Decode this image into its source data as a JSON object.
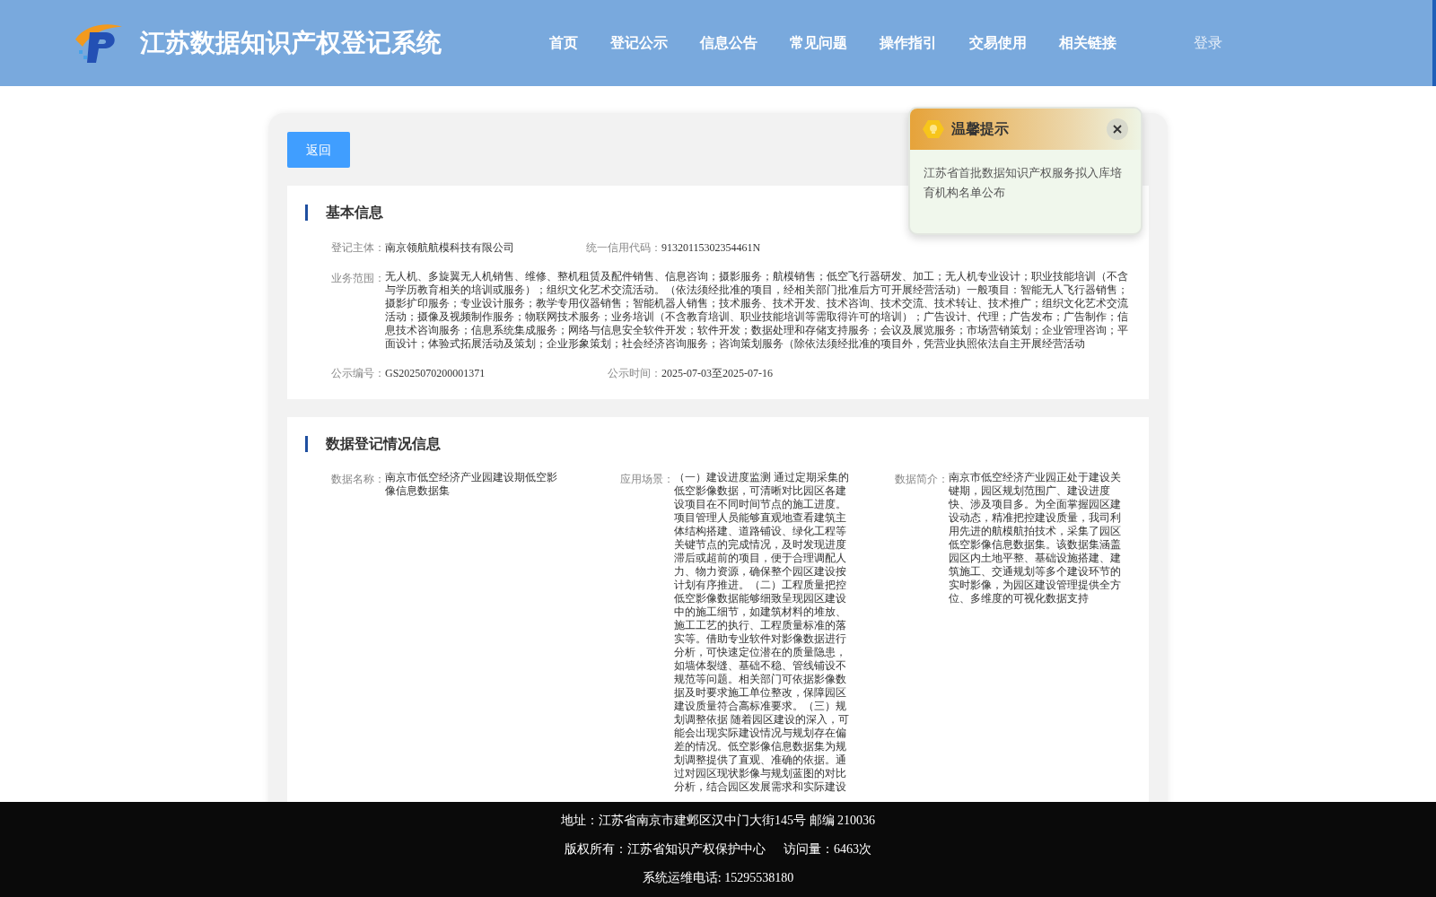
{
  "header": {
    "title": "江苏数据知识产权登记系统",
    "nav": [
      "首页",
      "登记公示",
      "信息公告",
      "常见问题",
      "操作指引",
      "交易使用",
      "相关链接"
    ],
    "login": "登录"
  },
  "back_button": "返回",
  "basic_info": {
    "heading": "基本信息",
    "fields": [
      {
        "label": "登记主体：",
        "value": "南京领航航模科技有限公司"
      },
      {
        "label": "统一信用代码：",
        "value": "91320115302354461N"
      },
      {
        "label": "业务范围：",
        "value": "无人机、多旋翼无人机销售、维修、整机租赁及配件销售、信息咨询；摄影服务；航模销售；低空飞行器研发、加工；无人机专业设计；职业技能培训（不含与学历教育相关的培训或服务）；组织文化艺术交流活动。（依法须经批准的项目，经相关部门批准后方可开展经营活动）一般项目：智能无人飞行器销售；摄影扩印服务；专业设计服务；教学专用仪器销售；智能机器人销售；技术服务、技术开发、技术咨询、技术交流、技术转让、技术推广；组织文化艺术交流活动；摄像及视频制作服务；物联网技术服务；业务培训（不含教育培训、职业技能培训等需取得许可的培训）；广告设计、代理；广告发布；广告制作；信息技术咨询服务；信息系统集成服务；网络与信息安全软件开发；软件开发；数据处理和存储支持服务；会议及展览服务；市场营销策划；企业管理咨询；平面设计；体验式拓展活动及策划；企业形象策划；社会经济咨询服务；咨询策划服务（除依法须经批准的项目外，凭营业执照依法自主开展经营活动"
      },
      {
        "label": "公示编号：",
        "value": "GS2025070200001371"
      },
      {
        "label": "公示时间：",
        "value": "2025-07-03至2025-07-16"
      }
    ]
  },
  "data_info": {
    "heading": "数据登记情况信息",
    "fields": [
      {
        "label": "数据名称：",
        "value": "南京市低空经济产业园建设期低空影像信息数据集"
      },
      {
        "label": "应用场景：",
        "value": "（一）建设进度监测 通过定期采集的低空影像数据，可清晰对比园区各建设项目在不同时间节点的施工进度。项目管理人员能够直观地查看建筑主体结构搭建、道路铺设、绿化工程等关键节点的完成情况，及时发现进度滞后或超前的项目，便于合理调配人力、物力资源，确保整个园区建设按计划有序推进。（二）工程质量把控低空影像数据能够细致呈现园区建设中的施工细节，如建筑材料的堆放、施工工艺的执行、工程质量标准的落实等。借助专业软件对影像数据进行分析，可快速定位潜在的质量隐患，如墙体裂缝、基础不稳、管线铺设不规范等问题。相关部门可依据影像数据及时要求施工单位整改，保障园区建设质量符合高标准要求。（三）规划调整依据 随着园区建设的深入，可能会出现实际建设情况与规划存在偏差的情况。低空影像信息数据集为规划调整提供了直观、准确的依据。通过对园区现状影像与规划蓝图的对比分析，结合园区发展需求和实际建设"
      },
      {
        "label": "数据简介：",
        "value": "南京市低空经济产业园正处于建设关键期，园区规划范围广、建设进度快、涉及项目多。为全面掌握园区建设动态，精准把控建设质量，我司利用先进的航模航拍技术，采集了园区低空影像信息数据集。该数据集涵盖园区内土地平整、基础设施搭建、建筑施工、交通规划等多个建设环节的实时影像，为园区建设管理提供全方位、多维度的可视化数据支持"
      }
    ]
  },
  "notice": {
    "title": "温馨提示",
    "message": "江苏省首批数据知识产权服务拟入库培育机构名单公布"
  },
  "footer": {
    "lines": [
      "地址：江苏省南京市建邺区汉中门大街145号 邮编 210036",
      "版权所有：江苏省知识产权保护中心",
      "访问量：6463次",
      "系统运维电话: 15295538180"
    ]
  }
}
